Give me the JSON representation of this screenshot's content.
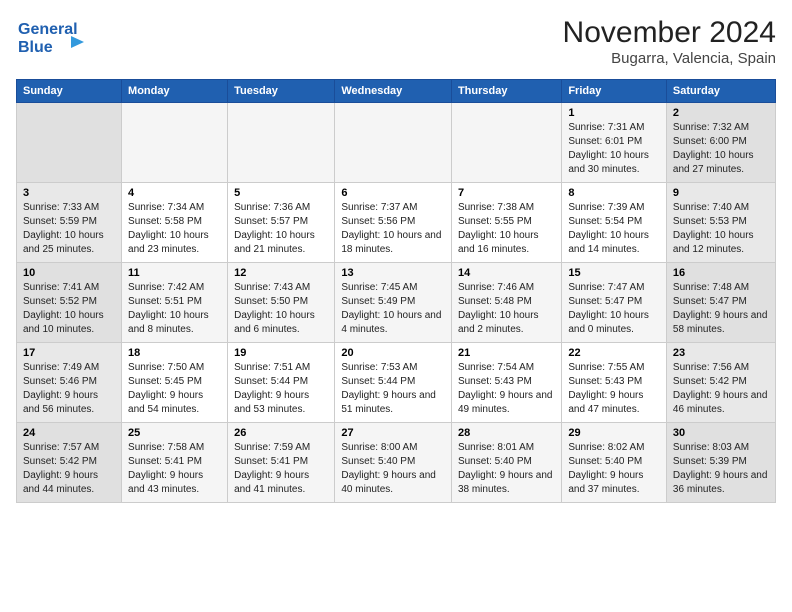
{
  "header": {
    "logo_line1": "General",
    "logo_line2": "Blue",
    "month_title": "November 2024",
    "subtitle": "Bugarra, Valencia, Spain"
  },
  "days_of_week": [
    "Sunday",
    "Monday",
    "Tuesday",
    "Wednesday",
    "Thursday",
    "Friday",
    "Saturday"
  ],
  "weeks": [
    [
      {
        "day": "",
        "info": ""
      },
      {
        "day": "",
        "info": ""
      },
      {
        "day": "",
        "info": ""
      },
      {
        "day": "",
        "info": ""
      },
      {
        "day": "",
        "info": ""
      },
      {
        "day": "1",
        "info": "Sunrise: 7:31 AM\nSunset: 6:01 PM\nDaylight: 10 hours and 30 minutes."
      },
      {
        "day": "2",
        "info": "Sunrise: 7:32 AM\nSunset: 6:00 PM\nDaylight: 10 hours and 27 minutes."
      }
    ],
    [
      {
        "day": "3",
        "info": "Sunrise: 7:33 AM\nSunset: 5:59 PM\nDaylight: 10 hours and 25 minutes."
      },
      {
        "day": "4",
        "info": "Sunrise: 7:34 AM\nSunset: 5:58 PM\nDaylight: 10 hours and 23 minutes."
      },
      {
        "day": "5",
        "info": "Sunrise: 7:36 AM\nSunset: 5:57 PM\nDaylight: 10 hours and 21 minutes."
      },
      {
        "day": "6",
        "info": "Sunrise: 7:37 AM\nSunset: 5:56 PM\nDaylight: 10 hours and 18 minutes."
      },
      {
        "day": "7",
        "info": "Sunrise: 7:38 AM\nSunset: 5:55 PM\nDaylight: 10 hours and 16 minutes."
      },
      {
        "day": "8",
        "info": "Sunrise: 7:39 AM\nSunset: 5:54 PM\nDaylight: 10 hours and 14 minutes."
      },
      {
        "day": "9",
        "info": "Sunrise: 7:40 AM\nSunset: 5:53 PM\nDaylight: 10 hours and 12 minutes."
      }
    ],
    [
      {
        "day": "10",
        "info": "Sunrise: 7:41 AM\nSunset: 5:52 PM\nDaylight: 10 hours and 10 minutes."
      },
      {
        "day": "11",
        "info": "Sunrise: 7:42 AM\nSunset: 5:51 PM\nDaylight: 10 hours and 8 minutes."
      },
      {
        "day": "12",
        "info": "Sunrise: 7:43 AM\nSunset: 5:50 PM\nDaylight: 10 hours and 6 minutes."
      },
      {
        "day": "13",
        "info": "Sunrise: 7:45 AM\nSunset: 5:49 PM\nDaylight: 10 hours and 4 minutes."
      },
      {
        "day": "14",
        "info": "Sunrise: 7:46 AM\nSunset: 5:48 PM\nDaylight: 10 hours and 2 minutes."
      },
      {
        "day": "15",
        "info": "Sunrise: 7:47 AM\nSunset: 5:47 PM\nDaylight: 10 hours and 0 minutes."
      },
      {
        "day": "16",
        "info": "Sunrise: 7:48 AM\nSunset: 5:47 PM\nDaylight: 9 hours and 58 minutes."
      }
    ],
    [
      {
        "day": "17",
        "info": "Sunrise: 7:49 AM\nSunset: 5:46 PM\nDaylight: 9 hours and 56 minutes."
      },
      {
        "day": "18",
        "info": "Sunrise: 7:50 AM\nSunset: 5:45 PM\nDaylight: 9 hours and 54 minutes."
      },
      {
        "day": "19",
        "info": "Sunrise: 7:51 AM\nSunset: 5:44 PM\nDaylight: 9 hours and 53 minutes."
      },
      {
        "day": "20",
        "info": "Sunrise: 7:53 AM\nSunset: 5:44 PM\nDaylight: 9 hours and 51 minutes."
      },
      {
        "day": "21",
        "info": "Sunrise: 7:54 AM\nSunset: 5:43 PM\nDaylight: 9 hours and 49 minutes."
      },
      {
        "day": "22",
        "info": "Sunrise: 7:55 AM\nSunset: 5:43 PM\nDaylight: 9 hours and 47 minutes."
      },
      {
        "day": "23",
        "info": "Sunrise: 7:56 AM\nSunset: 5:42 PM\nDaylight: 9 hours and 46 minutes."
      }
    ],
    [
      {
        "day": "24",
        "info": "Sunrise: 7:57 AM\nSunset: 5:42 PM\nDaylight: 9 hours and 44 minutes."
      },
      {
        "day": "25",
        "info": "Sunrise: 7:58 AM\nSunset: 5:41 PM\nDaylight: 9 hours and 43 minutes."
      },
      {
        "day": "26",
        "info": "Sunrise: 7:59 AM\nSunset: 5:41 PM\nDaylight: 9 hours and 41 minutes."
      },
      {
        "day": "27",
        "info": "Sunrise: 8:00 AM\nSunset: 5:40 PM\nDaylight: 9 hours and 40 minutes."
      },
      {
        "day": "28",
        "info": "Sunrise: 8:01 AM\nSunset: 5:40 PM\nDaylight: 9 hours and 38 minutes."
      },
      {
        "day": "29",
        "info": "Sunrise: 8:02 AM\nSunset: 5:40 PM\nDaylight: 9 hours and 37 minutes."
      },
      {
        "day": "30",
        "info": "Sunrise: 8:03 AM\nSunset: 5:39 PM\nDaylight: 9 hours and 36 minutes."
      }
    ]
  ]
}
